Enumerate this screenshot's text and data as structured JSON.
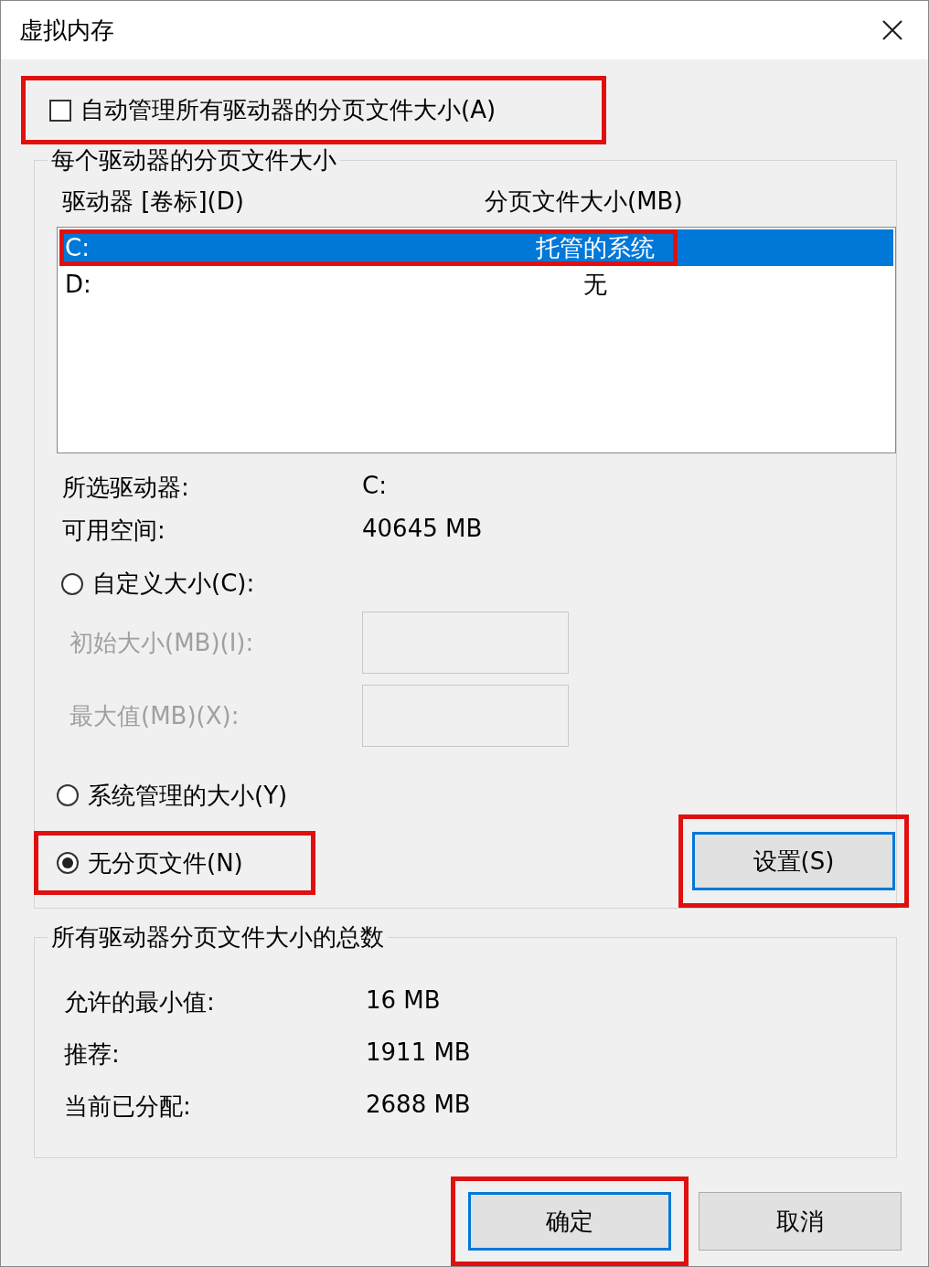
{
  "window": {
    "title": "虚拟内存"
  },
  "auto_manage": {
    "label": "自动管理所有驱动器的分页文件大小(A)",
    "checked": false,
    "highlighted": true
  },
  "per_drive": {
    "title": "每个驱动器的分页文件大小",
    "columns": [
      "驱动器 [卷标](D)",
      "分页文件大小(MB)"
    ],
    "drives": [
      {
        "drive": "C:",
        "size": "托管的系统",
        "selected": true,
        "highlighted": true
      },
      {
        "drive": "D:",
        "size": "无",
        "selected": false,
        "highlighted": false
      }
    ],
    "info": [
      {
        "label": "所选驱动器:",
        "value": "C:"
      },
      {
        "label": "可用空间:",
        "value": "40645 MB"
      }
    ],
    "options": [
      {
        "label": "自定义大小(C):",
        "selected": false,
        "highlighted": false,
        "fields": [
          {
            "label": "初始大小(MB)(I):",
            "disabled": true
          },
          {
            "label": "最大值(MB)(X):",
            "disabled": true
          }
        ]
      },
      {
        "label": "系统管理的大小(Y)",
        "selected": false,
        "highlighted": false
      },
      {
        "label": "无分页文件(N)",
        "selected": true,
        "highlighted": true
      }
    ],
    "set_button": {
      "label": "设置(S)",
      "highlighted": true
    }
  },
  "totals": {
    "title": "所有驱动器分页文件大小的总数",
    "rows": [
      {
        "label": "允许的最小值:",
        "value": "16 MB"
      },
      {
        "label": "推荐:",
        "value": "1911 MB"
      },
      {
        "label": "当前已分配:",
        "value": "2688 MB"
      }
    ]
  },
  "buttons": [
    {
      "label": "确定",
      "default": true,
      "highlighted": true
    },
    {
      "label": "取消",
      "default": false,
      "highlighted": false
    }
  ]
}
